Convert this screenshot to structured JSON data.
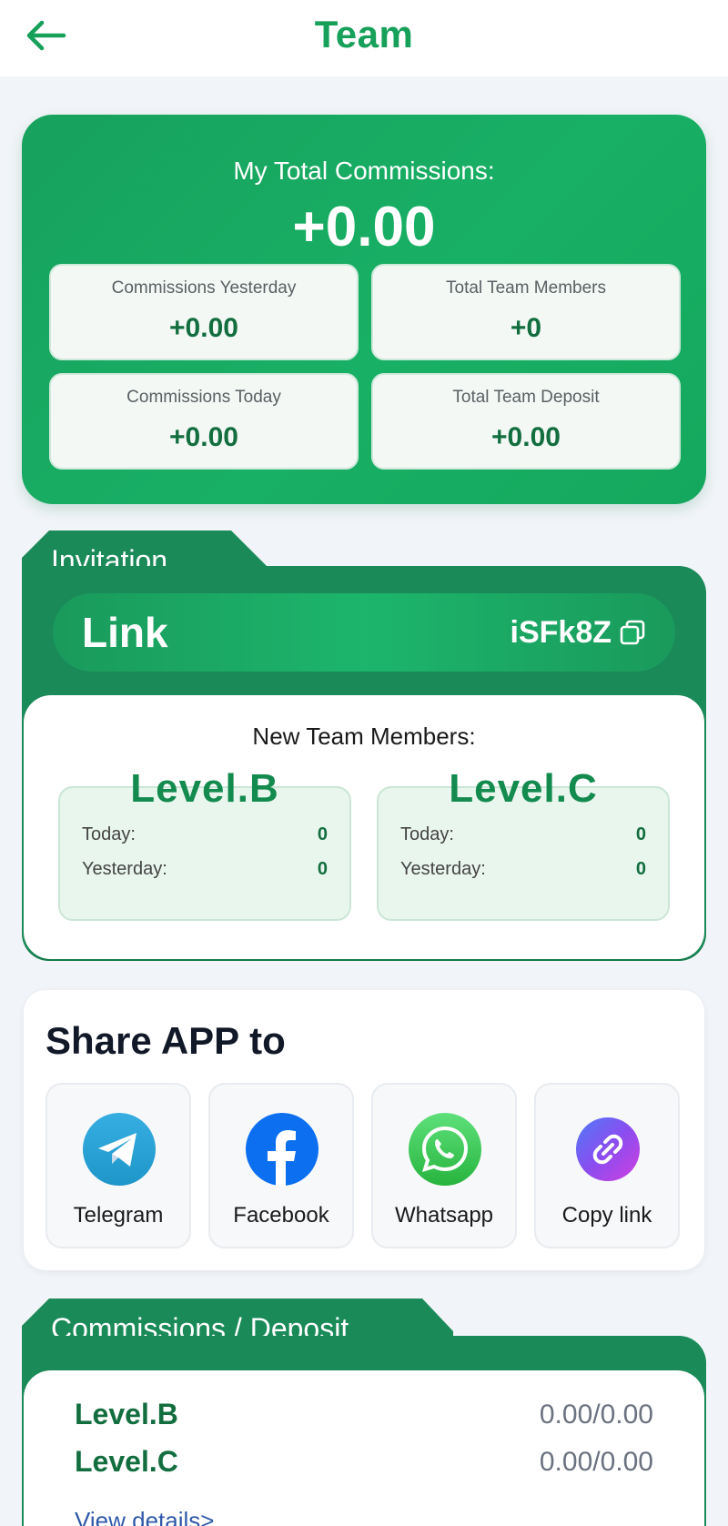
{
  "header": {
    "title": "Team"
  },
  "commissions": {
    "title": "My Total Commissions:",
    "total": "+0.00",
    "stats": [
      {
        "label": "Commissions Yesterday",
        "value": "+0.00"
      },
      {
        "label": "Total Team Members",
        "value": "+0"
      },
      {
        "label": "Commissions Today",
        "value": "+0.00"
      },
      {
        "label": "Total Team Deposit",
        "value": "+0.00"
      }
    ]
  },
  "invitation": {
    "tab_label": "Invitation",
    "link_label": "Link",
    "code": "iSFk8Z",
    "new_members_title": "New Team Members:",
    "levels": [
      {
        "name": "Level.B",
        "today_label": "Today:",
        "today": "0",
        "yesterday_label": "Yesterday:",
        "yesterday": "0"
      },
      {
        "name": "Level.C",
        "today_label": "Today:",
        "today": "0",
        "yesterday_label": "Yesterday:",
        "yesterday": "0"
      }
    ]
  },
  "share": {
    "title": "Share APP to",
    "items": [
      {
        "label": "Telegram",
        "icon": "telegram-icon"
      },
      {
        "label": "Facebook",
        "icon": "facebook-icon"
      },
      {
        "label": "Whatsapp",
        "icon": "whatsapp-icon"
      },
      {
        "label": "Copy link",
        "icon": "copy-link-icon"
      }
    ]
  },
  "commission_deposit": {
    "tab_label": "Commissions / Deposit",
    "rows": [
      {
        "level": "Level.B",
        "value": "0.00/0.00"
      },
      {
        "level": "Level.C",
        "value": "0.00/0.00"
      }
    ],
    "view_details": "View details>"
  },
  "colors": {
    "brand_green": "#16a05a",
    "dark_green": "#1a8a58",
    "value_green": "#136e3f",
    "background": "#f1f4f8"
  }
}
